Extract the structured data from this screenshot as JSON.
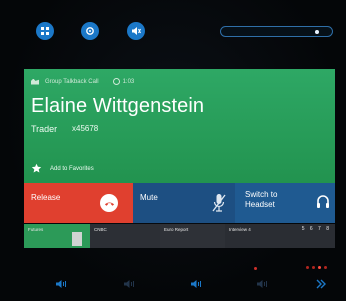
{
  "top_bar": {
    "icons": [
      "grid-icon",
      "settings-icon",
      "speaker-mute-icon"
    ],
    "volume_level": 0.88
  },
  "call_card": {
    "meta_label": "Group Talkback Call",
    "timer": "1:03",
    "caller_name": "Elaine Wittgenstein",
    "caller_role": "Trader",
    "caller_ext": "x45678",
    "favorites_label": "Add to Favorites"
  },
  "actions": {
    "release_label": "Release",
    "mute_label": "Mute",
    "headset_label": "Switch to Headset"
  },
  "line_keys": [
    {
      "label": "Futures",
      "state": "active"
    },
    {
      "label": "CNBC",
      "state": "idle"
    },
    {
      "label": "Euro Report",
      "state": "idle"
    },
    {
      "label": "Interview 4",
      "digits": "5 6 7 8",
      "state": "idle"
    }
  ],
  "bottom_nav": {
    "icons": [
      "speaker-icon-1",
      "speaker-icon-2",
      "speaker-icon-3",
      "speaker-icon-4",
      "next-icon"
    ],
    "page_indicator": {
      "total": 4,
      "active": 2
    }
  },
  "colors": {
    "call_green": "#2ea865",
    "release_red": "#e0402f",
    "mute_blue": "#1d4f82",
    "accent_blue": "#1b78c8",
    "alert_red": "#d0302a"
  }
}
